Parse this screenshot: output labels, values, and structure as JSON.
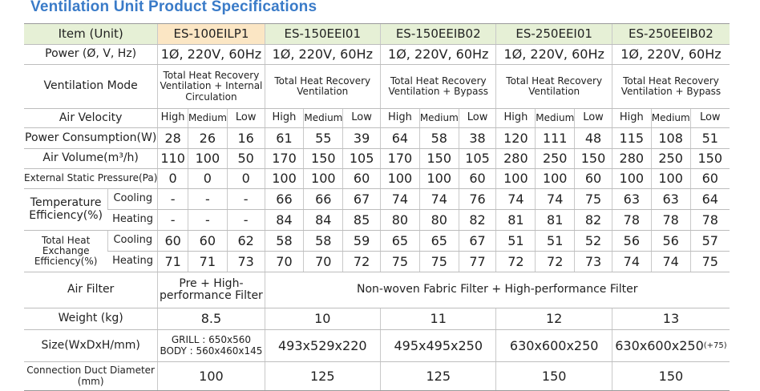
{
  "page": {
    "title": "Ventilation Unit Product Specifications"
  },
  "header": {
    "item_label": "Item (Unit)",
    "models": [
      "ES-100EILP1",
      "ES-150EEI01",
      "ES-150EEIB02",
      "ES-250EEI01",
      "ES-250EEIB02"
    ]
  },
  "rows": {
    "power": {
      "label": "Power (Ø, V, Hz)",
      "values": [
        "1Ø, 220V, 60Hz",
        "1Ø, 220V, 60Hz",
        "1Ø, 220V, 60Hz",
        "1Ø, 220V, 60Hz",
        "1Ø, 220V, 60Hz"
      ]
    },
    "mode": {
      "label": "Ventilation Mode",
      "values": [
        "Total Heat Recovery Ventilation + Internal Circulation",
        "Total Heat Recovery Ventilation",
        "Total Heat Recovery Ventilation + Bypass",
        "Total Heat Recovery Ventilation",
        "Total Heat Recovery Ventilation + Bypass"
      ]
    },
    "velocity": {
      "label": "Air Velocity",
      "speeds": [
        "High",
        "Medium",
        "Low"
      ]
    },
    "consumption": {
      "label": "Power Consumption(W)",
      "values": [
        "28",
        "26",
        "16",
        "61",
        "55",
        "39",
        "64",
        "58",
        "38",
        "120",
        "111",
        "48",
        "115",
        "108",
        "51"
      ]
    },
    "volume": {
      "label": "Air Volume(m³/h)",
      "values": [
        "110",
        "100",
        "50",
        "170",
        "150",
        "105",
        "170",
        "150",
        "105",
        "280",
        "250",
        "150",
        "280",
        "250",
        "150"
      ]
    },
    "pressure": {
      "label": "External Static Pressure(Pa)",
      "values": [
        "0",
        "0",
        "0",
        "100",
        "100",
        "60",
        "100",
        "100",
        "60",
        "100",
        "100",
        "60",
        "100",
        "100",
        "60"
      ]
    },
    "temp_eff": {
      "label": "Temperature Efficiency(%)",
      "cooling_label": "Cooling",
      "heating_label": "Heating",
      "cooling": [
        "-",
        "-",
        "-",
        "66",
        "66",
        "67",
        "74",
        "74",
        "76",
        "74",
        "74",
        "75",
        "63",
        "63",
        "64"
      ],
      "heating": [
        "-",
        "-",
        "-",
        "84",
        "84",
        "85",
        "80",
        "80",
        "82",
        "81",
        "81",
        "82",
        "78",
        "78",
        "78"
      ]
    },
    "heat_eff": {
      "label": "Total Heat Exchange Efficiency(%)",
      "cooling_label": "Cooling",
      "heating_label": "Heating",
      "cooling": [
        "60",
        "60",
        "62",
        "58",
        "58",
        "59",
        "65",
        "65",
        "67",
        "51",
        "51",
        "52",
        "56",
        "56",
        "57"
      ],
      "heating": [
        "71",
        "71",
        "73",
        "70",
        "70",
        "72",
        "75",
        "75",
        "77",
        "72",
        "72",
        "73",
        "74",
        "74",
        "75"
      ]
    },
    "filter": {
      "label": "Air Filter",
      "first": "Pre + High-performance Filter",
      "rest": "Non-woven Fabric Filter + High-performance Filter"
    },
    "weight": {
      "label": "Weight (kg)",
      "values": [
        "8.5",
        "10",
        "11",
        "12",
        "13"
      ]
    },
    "size": {
      "label": "Size(WxDxH/mm)",
      "grill": "GRILL : 650x560",
      "body": "BODY : 560x460x145",
      "values": [
        "493x529x220",
        "495x495x250",
        "630x600x250",
        "630x600x250"
      ],
      "note": "(+75)"
    },
    "duct": {
      "label": "Connection Duct Diameter (mm)",
      "values": [
        "100",
        "125",
        "125",
        "150",
        "150"
      ]
    }
  }
}
